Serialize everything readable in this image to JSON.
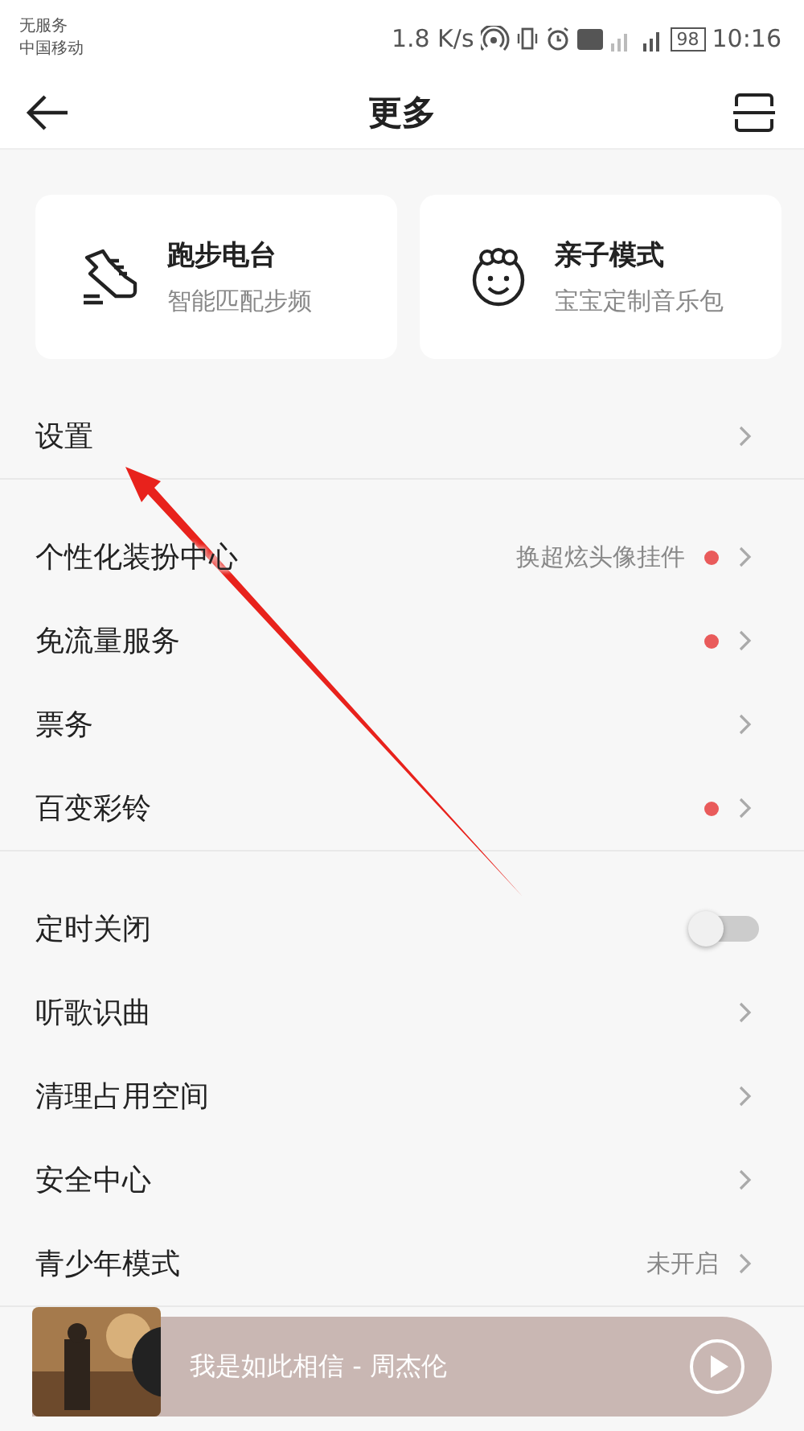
{
  "status_bar": {
    "carrier_lines": [
      "无服务",
      "中国移动"
    ],
    "speed": "1.8 K/s",
    "battery": "98",
    "time": "10:16"
  },
  "header": {
    "title": "更多"
  },
  "feature_cards": [
    {
      "title": "跑步电台",
      "subtitle": "智能匹配步频"
    },
    {
      "title": "亲子模式",
      "subtitle": "宝宝定制音乐包"
    }
  ],
  "groups": [
    [
      {
        "kind": "link",
        "label": "设置",
        "badge": false
      }
    ],
    [
      {
        "kind": "link",
        "label": "个性化装扮中心",
        "value": "换超炫头像挂件",
        "badge": true
      },
      {
        "kind": "link",
        "label": "免流量服务",
        "badge": true
      },
      {
        "kind": "link",
        "label": "票务",
        "badge": false
      },
      {
        "kind": "link",
        "label": "百变彩铃",
        "badge": true
      }
    ],
    [
      {
        "kind": "toggle",
        "label": "定时关闭",
        "on": false
      },
      {
        "kind": "link",
        "label": "听歌识曲",
        "badge": false
      },
      {
        "kind": "link",
        "label": "清理占用空间",
        "badge": false
      },
      {
        "kind": "link",
        "label": "安全中心",
        "badge": false
      },
      {
        "kind": "link",
        "label": "青少年模式",
        "value": "未开启",
        "badge": false
      }
    ]
  ],
  "player": {
    "song": "我是如此相信 - 周杰伦"
  }
}
